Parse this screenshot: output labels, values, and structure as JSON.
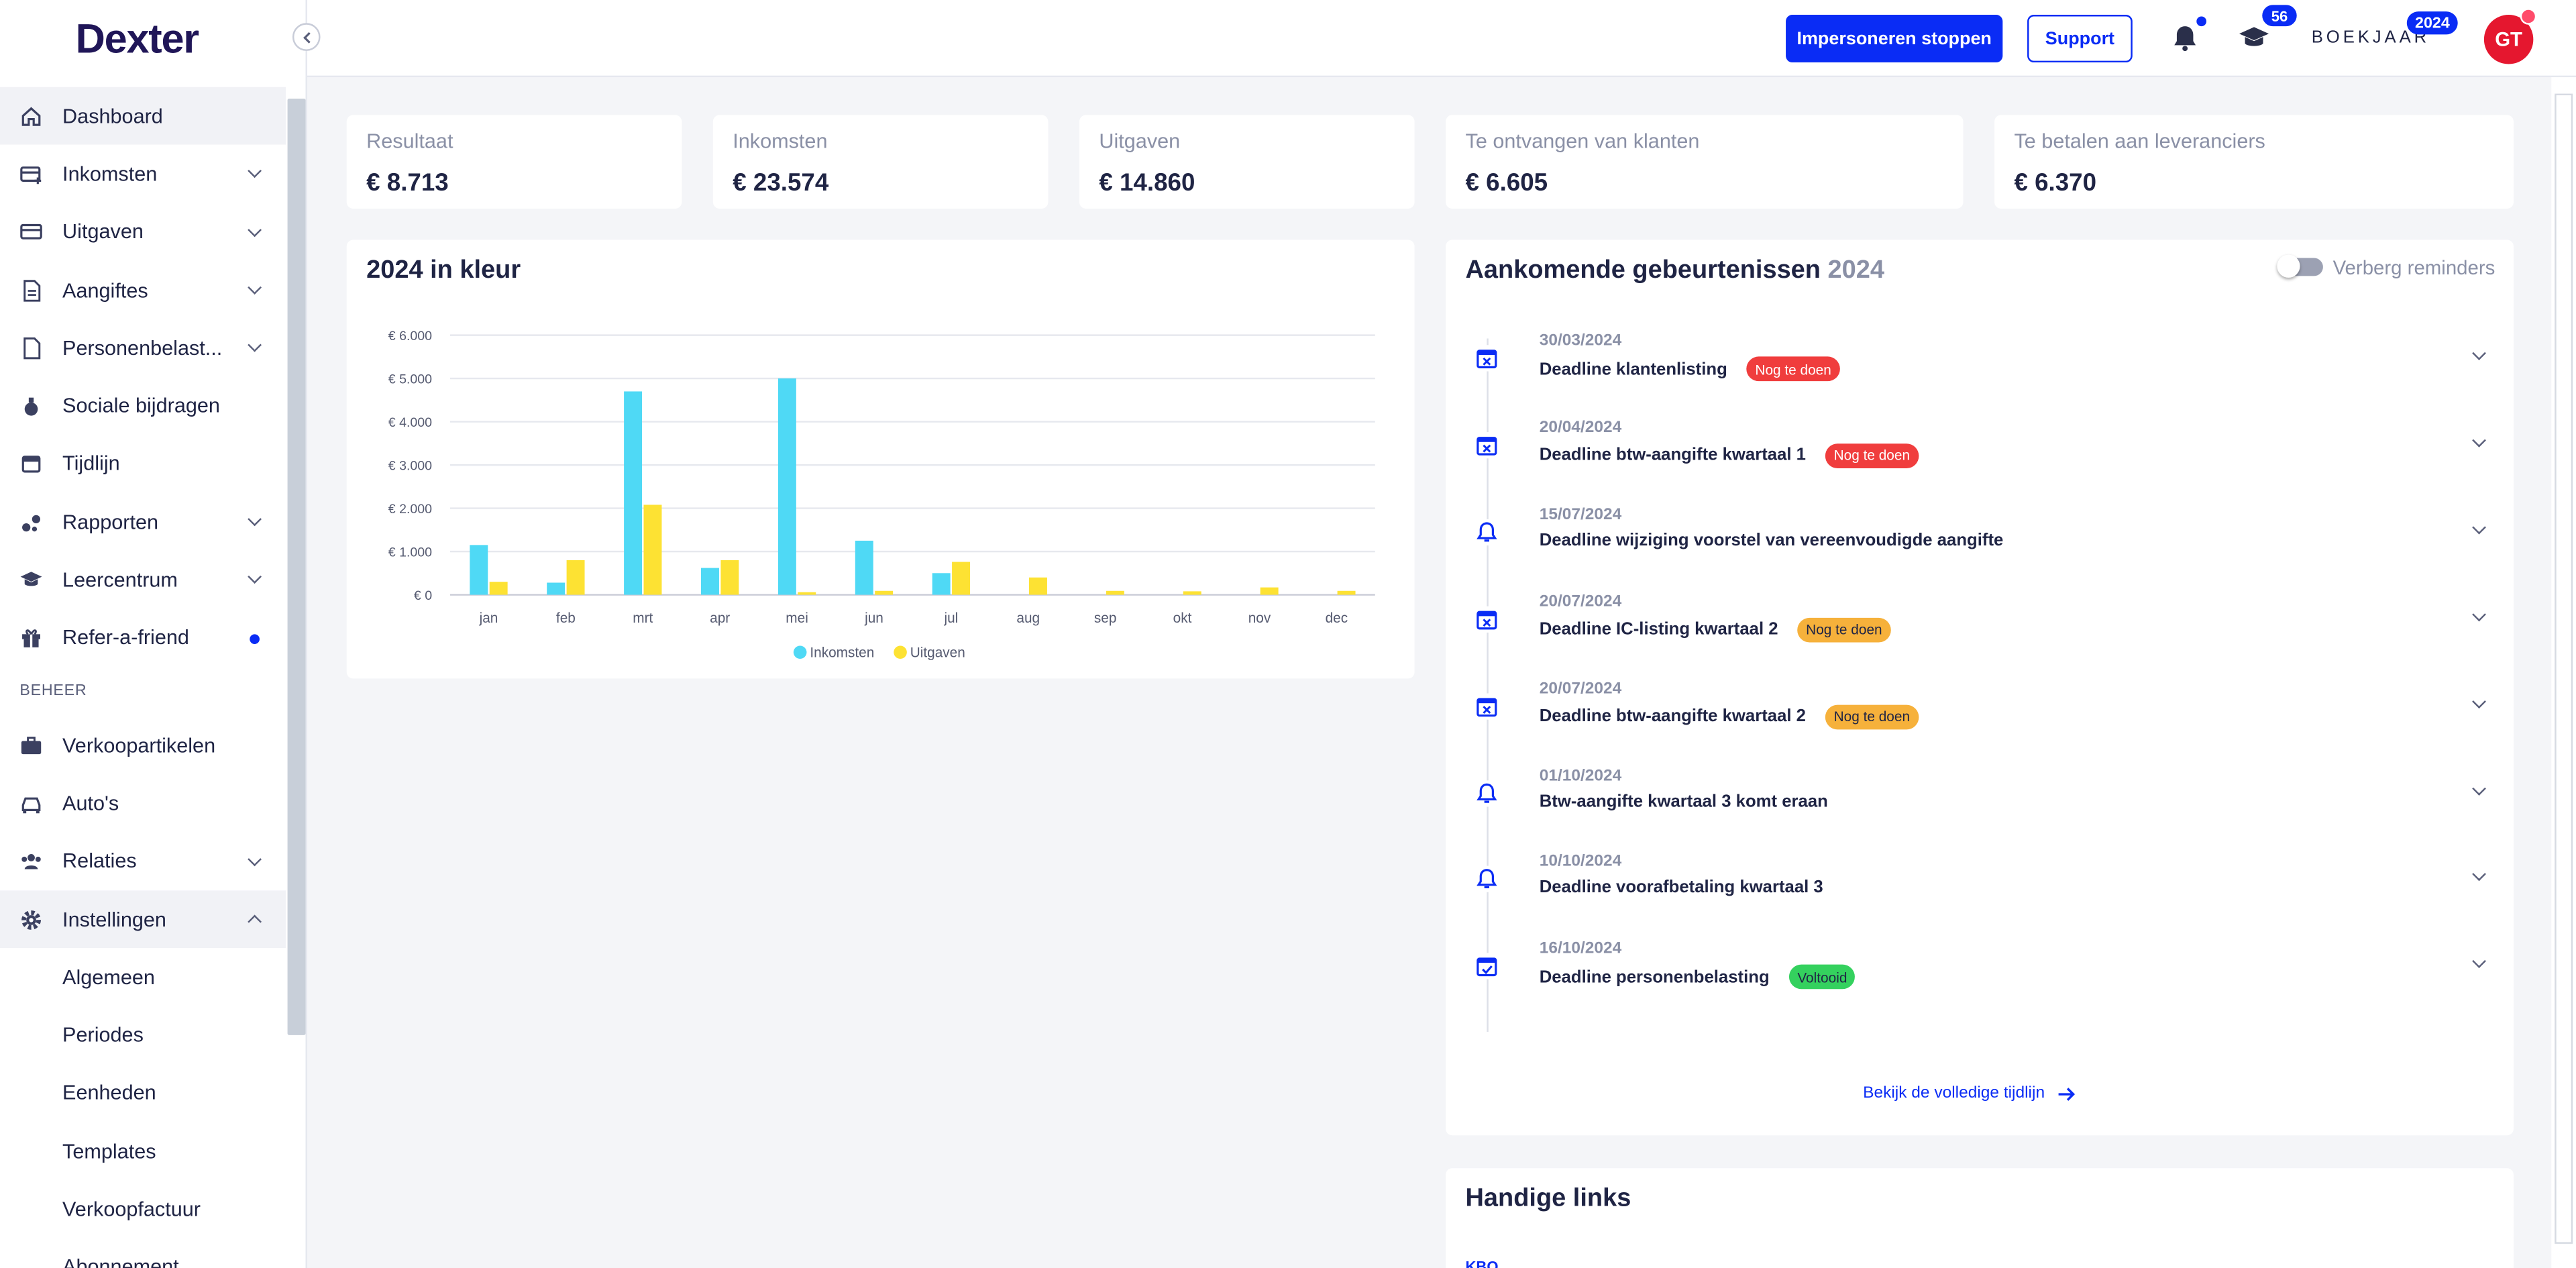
{
  "app": {
    "logo": "Dexter"
  },
  "sidebar": {
    "items": [
      {
        "label": "Dashboard"
      },
      {
        "label": "Inkomsten"
      },
      {
        "label": "Uitgaven"
      },
      {
        "label": "Aangiftes"
      },
      {
        "label": "Personenbelast..."
      },
      {
        "label": "Sociale bijdragen"
      },
      {
        "label": "Tijdlijn"
      },
      {
        "label": "Rapporten"
      },
      {
        "label": "Leercentrum"
      },
      {
        "label": "Refer-a-friend"
      }
    ],
    "section": "BEHEER",
    "beheer": [
      {
        "label": "Verkoopartikelen"
      },
      {
        "label": "Auto's"
      },
      {
        "label": "Relaties"
      },
      {
        "label": "Instellingen"
      }
    ],
    "sub": [
      {
        "label": "Algemeen"
      },
      {
        "label": "Periodes"
      },
      {
        "label": "Eenheden"
      },
      {
        "label": "Templates"
      },
      {
        "label": "Verkoopfactuur"
      },
      {
        "label": "Abonnement"
      }
    ]
  },
  "topbar": {
    "impersonate": "Impersoneren stoppen",
    "support": "Support",
    "learn_count": "56",
    "boekjaar": "BOEKJAAR",
    "year": "2024",
    "avatar": "GT"
  },
  "kpis": [
    {
      "label": "Resultaat",
      "value": "€ 8.713"
    },
    {
      "label": "Inkomsten",
      "value": "€ 23.574"
    },
    {
      "label": "Uitgaven",
      "value": "€ 14.860"
    },
    {
      "label": "Te ontvangen van klanten",
      "value": "€ 6.605"
    },
    {
      "label": "Te betalen aan leveranciers",
      "value": "€ 6.370"
    }
  ],
  "chart_card": {
    "title": "2024 in kleur"
  },
  "chart_data": {
    "type": "bar",
    "categories": [
      "jan",
      "feb",
      "mrt",
      "apr",
      "mei",
      "jun",
      "jul",
      "aug",
      "sep",
      "okt",
      "nov",
      "dec"
    ],
    "series": [
      {
        "name": "Inkomsten",
        "color": "#4fd9f5",
        "values": [
          1150,
          280,
          4700,
          620,
          5000,
          1250,
          500,
          0,
          0,
          0,
          0,
          0
        ]
      },
      {
        "name": "Uitgaven",
        "color": "#fde233",
        "values": [
          300,
          800,
          2080,
          800,
          60,
          90,
          760,
          400,
          90,
          80,
          170,
          90
        ]
      }
    ],
    "ylim": [
      0,
      6000
    ],
    "yticks": [
      0,
      1000,
      2000,
      3000,
      4000,
      5000,
      6000
    ],
    "ytick_labels": [
      "€ 0",
      "€ 1.000",
      "€ 2.000",
      "€ 3.000",
      "€ 4.000",
      "€ 5.000",
      "€ 6.000"
    ],
    "legend": "bottom",
    "grid": true
  },
  "events_card": {
    "title": "Aankomende gebeurtenissen",
    "year": "2024",
    "toggle_label": "Verberg reminders",
    "link": "Bekijk de volledige tijdlijn",
    "events": [
      {
        "date": "30/03/2024",
        "title": "Deadline klantenlisting",
        "badge": "Nog te doen",
        "badge_color": "red",
        "icon": "calendar-x-icon"
      },
      {
        "date": "20/04/2024",
        "title": "Deadline btw-aangifte kwartaal 1",
        "badge": "Nog te doen",
        "badge_color": "red",
        "icon": "calendar-x-icon"
      },
      {
        "date": "15/07/2024",
        "title": "Deadline wijziging voorstel van vereenvoudigde aangifte",
        "badge": "",
        "badge_color": "",
        "icon": "bell-icon"
      },
      {
        "date": "20/07/2024",
        "title": "Deadline IC-listing kwartaal 2",
        "badge": "Nog te doen",
        "badge_color": "orange",
        "icon": "calendar-x-icon"
      },
      {
        "date": "20/07/2024",
        "title": "Deadline btw-aangifte kwartaal 2",
        "badge": "Nog te doen",
        "badge_color": "orange",
        "icon": "calendar-x-icon"
      },
      {
        "date": "01/10/2024",
        "title": "Btw-aangifte kwartaal 3 komt eraan",
        "badge": "",
        "badge_color": "",
        "icon": "bell-icon"
      },
      {
        "date": "10/10/2024",
        "title": "Deadline voorafbetaling kwartaal 3",
        "badge": "",
        "badge_color": "",
        "icon": "bell-icon"
      },
      {
        "date": "16/10/2024",
        "title": "Deadline personenbelasting",
        "badge": "Voltooid",
        "badge_color": "green",
        "icon": "calendar-check-icon"
      }
    ]
  },
  "links_card": {
    "title": "Handige links",
    "first_link": "KBO"
  }
}
